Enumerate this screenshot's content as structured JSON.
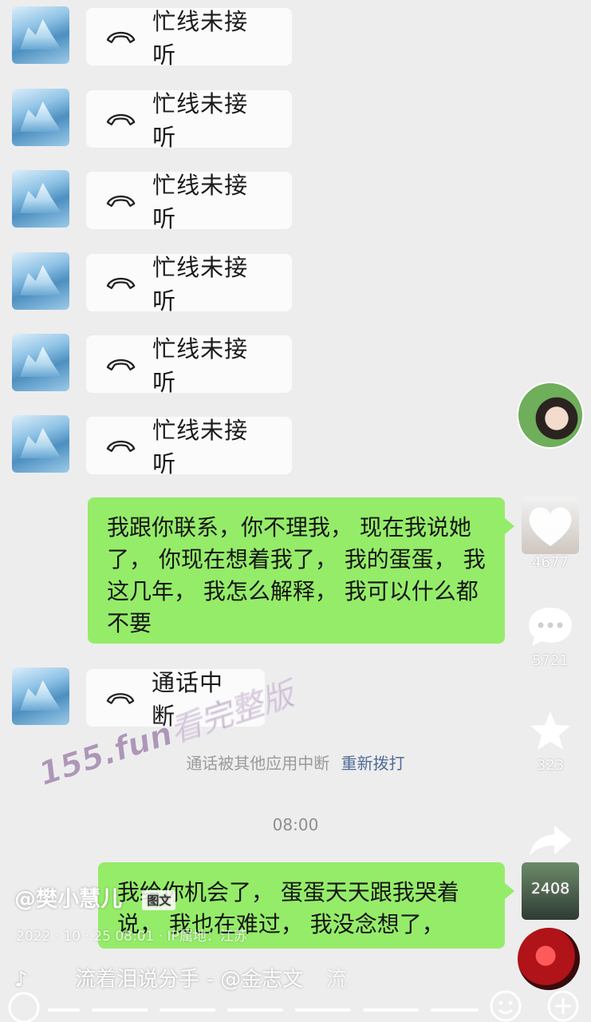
{
  "chat": {
    "missed_calls": [
      {
        "label": "忙线未接听"
      },
      {
        "label": "忙线未接听"
      },
      {
        "label": "忙线未接听"
      },
      {
        "label": "忙线未接听"
      },
      {
        "label": "忙线未接听"
      },
      {
        "label": "忙线未接听"
      }
    ],
    "outgoing_message_1": "我跟你联系，你不理我，  现在我说她了，  你现在想着我了，  我的蛋蛋，  我这几年，  我怎么解释，  我可以什么都不要",
    "interrupted_call": "通话中断",
    "system_note": "通话被其他应用中断",
    "redial_label": "重新拨打",
    "timestamp": "08:00",
    "outgoing_message_2": "我给你机会了，  蛋蛋天天跟我哭着说，  我也在难过，  我没念想了，"
  },
  "overlay": {
    "author": "@樊小慧儿",
    "tag": "图文",
    "post_time": "2022 · 10 · 25 08:01 · IP属地：江苏",
    "music": "流着泪说分手 - @金志文",
    "music_tail": "流",
    "likes": "4677",
    "comments": "5721",
    "favorites": "323",
    "shares": "2408",
    "watermark": "155.fun看完整版"
  }
}
